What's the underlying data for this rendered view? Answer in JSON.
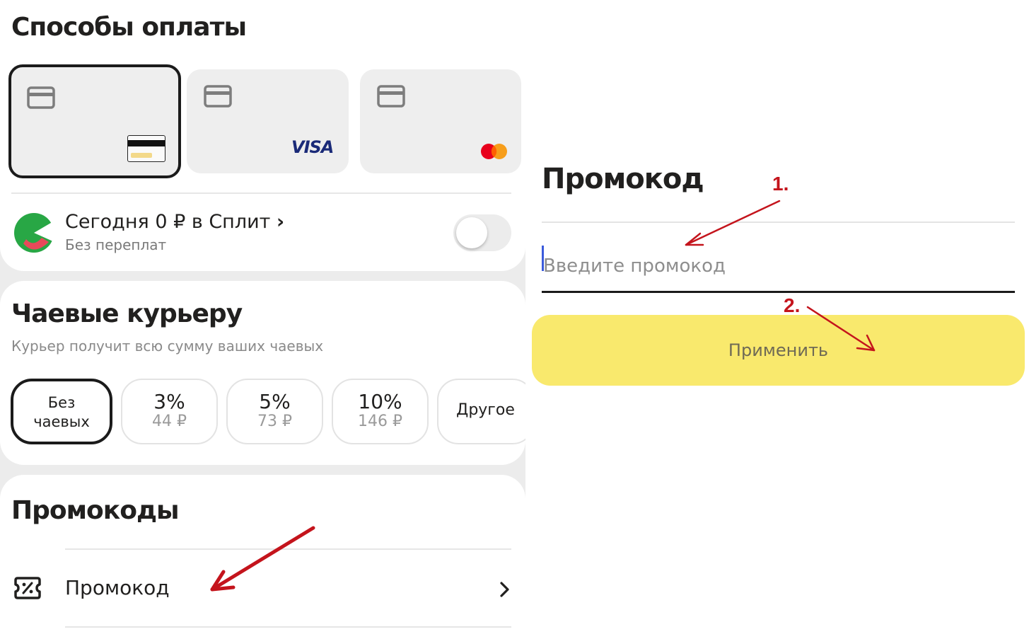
{
  "payment": {
    "title": "Способы оплаты",
    "cards": [
      {
        "icon": "card-icon",
        "brand_icon": "bank-card-icon",
        "selected": true
      },
      {
        "icon": "card-icon",
        "brand_text": "VISA",
        "selected": false
      },
      {
        "icon": "card-icon",
        "brand_icon": "mastercard-icon",
        "selected": false
      }
    ],
    "split": {
      "title": "Сегодня 0 ₽ в Сплит",
      "chevron": "›",
      "subtitle": "Без переплат",
      "toggle_on": false
    }
  },
  "tips": {
    "title": "Чаевые курьеру",
    "subtitle": "Курьер получит всю сумму ваших чаевых",
    "options": [
      {
        "line1": "Без",
        "line2": "чаевых",
        "selected": true
      },
      {
        "percent": "3%",
        "amount": "44 ₽"
      },
      {
        "percent": "5%",
        "amount": "73 ₽"
      },
      {
        "percent": "10%",
        "amount": "146 ₽"
      },
      {
        "label": "Другое"
      }
    ]
  },
  "promocodes": {
    "title": "Промокоды",
    "item_label": "Промокод"
  },
  "promo_dialog": {
    "title": "Промокод",
    "input_value": "",
    "input_placeholder": "Введите промокод",
    "apply_label": "Применить"
  },
  "annotations": {
    "step1": "1.",
    "step2": "2."
  },
  "colors": {
    "accent_yellow": "#f9e96d",
    "annotation_red": "#c4141c",
    "visa_blue": "#1a2a78"
  }
}
